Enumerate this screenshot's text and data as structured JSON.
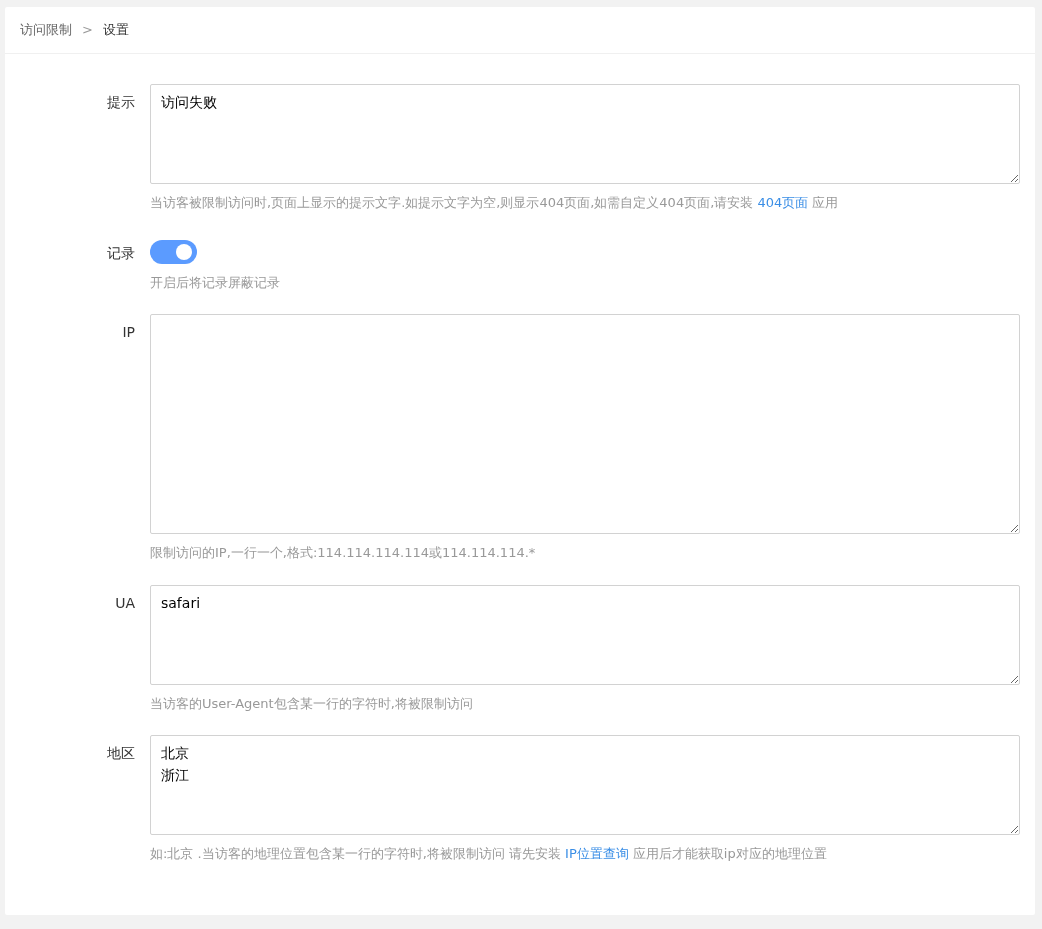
{
  "breadcrumb": [
    {
      "label": "访问限制",
      "current": false
    },
    {
      "label": "设置",
      "current": true
    }
  ],
  "breadcrumb_separator": ">",
  "fields": [
    {
      "kind": "textarea",
      "label": "提示",
      "lines": [
        "访问失败"
      ],
      "help": [
        {
          "kind": "text",
          "text": "当访客被限制访问时,页面上显示的提示文字.如提示文字为空,则显示404页面,如需自定义404页面,请安装 "
        },
        {
          "kind": "link",
          "text": "404页面"
        },
        {
          "kind": "text",
          "text": " 应用"
        }
      ]
    },
    {
      "kind": "switch",
      "label": "记录",
      "on": true,
      "help": [
        {
          "kind": "text",
          "text": "开启后将记录屏蔽记录"
        }
      ]
    },
    {
      "kind": "tall_textarea",
      "label": "IP",
      "help": [
        {
          "kind": "text",
          "text": "限制访问的IP,一行一个,格式:114.114.114.114或114.114.114.*"
        }
      ]
    },
    {
      "kind": "textarea",
      "label": "UA",
      "lines": [
        "safari"
      ],
      "help": [
        {
          "kind": "text",
          "text": "当访客的User-Agent包含某一行的字符时,将被限制访问"
        }
      ]
    },
    {
      "kind": "textarea",
      "label": "地区",
      "lines": [
        "北京",
        "浙江"
      ],
      "help": [
        {
          "kind": "text",
          "text": "如:北京 .当访客的地理位置包含某一行的字符时,将被限制访问 请先安装 "
        },
        {
          "kind": "link",
          "text": "IP位置查询"
        },
        {
          "kind": "text",
          "text": " 应用后才能获取ip对应的地理位置"
        }
      ]
    }
  ]
}
